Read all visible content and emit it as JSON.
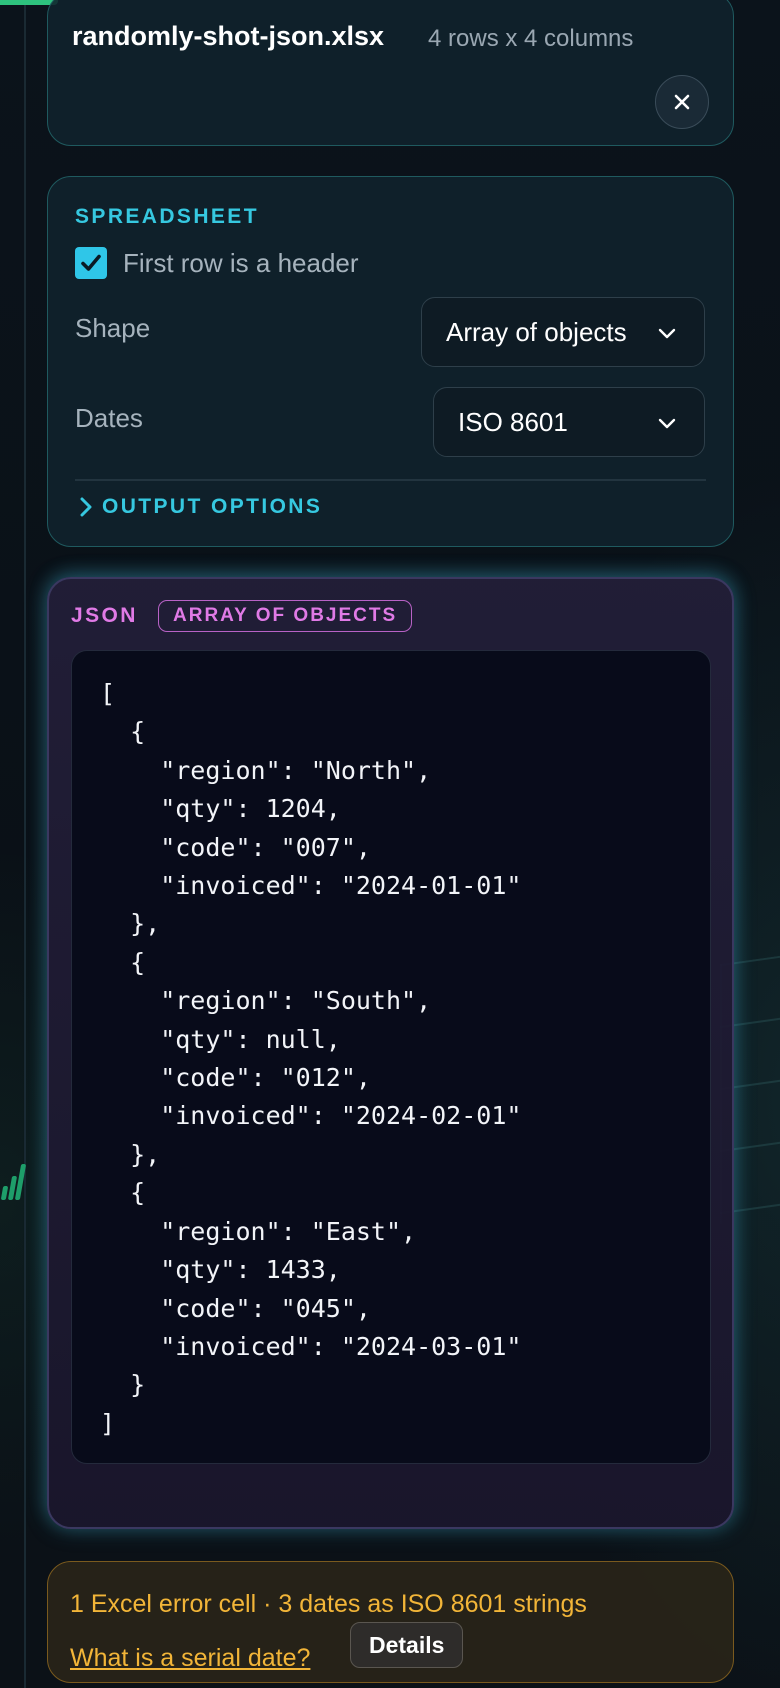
{
  "file": {
    "name": "randomly-shot-json.xlsx",
    "meta": "4 rows x 4 columns",
    "close_icon": "close-icon"
  },
  "spreadsheet": {
    "section_label": "SPREADSHEET",
    "header_checkbox": {
      "label": "First row is a header",
      "checked": true
    },
    "shape": {
      "label": "Shape",
      "value": "Array of objects"
    },
    "dates": {
      "label": "Dates",
      "value": "ISO 8601"
    },
    "output_options_label": "OUTPUT OPTIONS"
  },
  "json": {
    "label": "JSON",
    "badge": "ARRAY OF OBJECTS",
    "code": "[\n  {\n    \"region\": \"North\",\n    \"qty\": 1204,\n    \"code\": \"007\",\n    \"invoiced\": \"2024-01-01\"\n  },\n  {\n    \"region\": \"South\",\n    \"qty\": null,\n    \"code\": \"012\",\n    \"invoiced\": \"2024-02-01\"\n  },\n  {\n    \"region\": \"East\",\n    \"qty\": 1433,\n    \"code\": \"045\",\n    \"invoiced\": \"2024-03-01\"\n  }\n]"
  },
  "notice": {
    "text": "1 Excel error cell · 3 dates as ISO 8601 strings",
    "link": "What is a serial date?",
    "details_button": "Details"
  },
  "colors": {
    "accent_cyan": "#36c8e0",
    "accent_magenta": "#e07ae6",
    "warning_amber": "#f2b538"
  }
}
